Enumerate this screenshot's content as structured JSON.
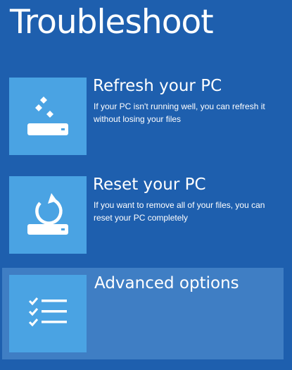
{
  "page": {
    "title": "Troubleshoot"
  },
  "options": [
    {
      "title": "Refresh your PC",
      "description": "If your PC isn't running well, you can refresh it without losing your files",
      "icon": "refresh-pc-icon"
    },
    {
      "title": "Reset your PC",
      "description": "If you want to remove all of your files, you can reset your PC completely",
      "icon": "reset-pc-icon"
    },
    {
      "title": "Advanced options",
      "description": "",
      "icon": "checklist-icon",
      "selected": true
    }
  ],
  "colors": {
    "background": "#1e5fae",
    "tile": "#4aa3e3",
    "selected_row": "#3f7ec4",
    "text": "#ffffff"
  }
}
